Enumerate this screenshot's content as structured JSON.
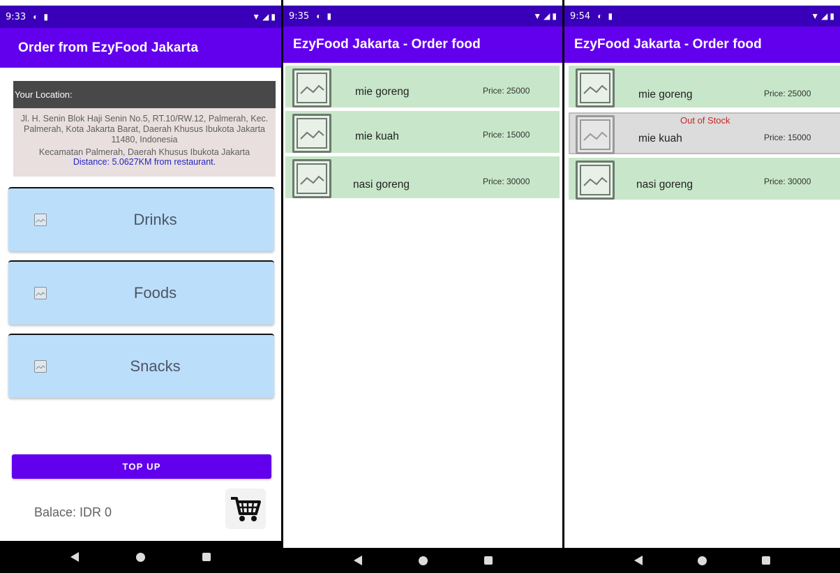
{
  "screen1": {
    "status": {
      "time": "9:33"
    },
    "appbar_title": "Order from EzyFood Jakarta",
    "location": {
      "header": "Your Location:",
      "address": "Jl. H. Senin Blok Haji Senin No.5, RT.10/RW.12, Palmerah, Kec. Palmerah, Kota Jakarta Barat, Daerah Khusus Ibukota Jakarta 11480, Indonesia",
      "area": "Kecamatan Palmerah, Daerah Khusus Ibukota Jakarta",
      "distance": "Distance: 5.0627KM from restaurant."
    },
    "categories": [
      {
        "label": "Drinks"
      },
      {
        "label": "Foods"
      },
      {
        "label": "Snacks"
      }
    ],
    "topup_label": "TOP UP",
    "balance": "Balace: IDR 0"
  },
  "screen2": {
    "status": {
      "time": "9:35"
    },
    "appbar_title": "EzyFood Jakarta - Order food",
    "items": [
      {
        "name": "mie goreng",
        "price": "Price: 25000"
      },
      {
        "name": "mie kuah",
        "price": "Price: 15000"
      },
      {
        "name": "nasi goreng",
        "price": "Price: 30000"
      }
    ]
  },
  "screen3": {
    "status": {
      "time": "9:54"
    },
    "appbar_title": "EzyFood Jakarta - Order food",
    "items": [
      {
        "name": "mie goreng",
        "price": "Price: 25000"
      },
      {
        "name": "mie kuah",
        "price": "Price: 15000",
        "stock_label": "Out of Stock"
      },
      {
        "name": "nasi goreng",
        "price": "Price: 30000"
      }
    ]
  },
  "icons": {
    "status_left": [
      "sync-icon",
      "sd-card-icon"
    ],
    "status_right": [
      "wifi-icon",
      "signal-icon",
      "battery-icon"
    ],
    "category_thumb": "image-placeholder-icon",
    "food_thumb": "image-placeholder-icon",
    "cart": "shopping-cart-icon",
    "nav": [
      "back-icon",
      "home-icon",
      "recents-icon"
    ]
  },
  "colors": {
    "status_bar": "#3a00b9",
    "app_bar": "#6200ee",
    "category_card": "#bbdefb",
    "food_row": "#c8e6c9",
    "out_of_stock_row": "#dcdcdc",
    "out_of_stock_text": "#c62828",
    "distance_text": "#2525c4"
  }
}
